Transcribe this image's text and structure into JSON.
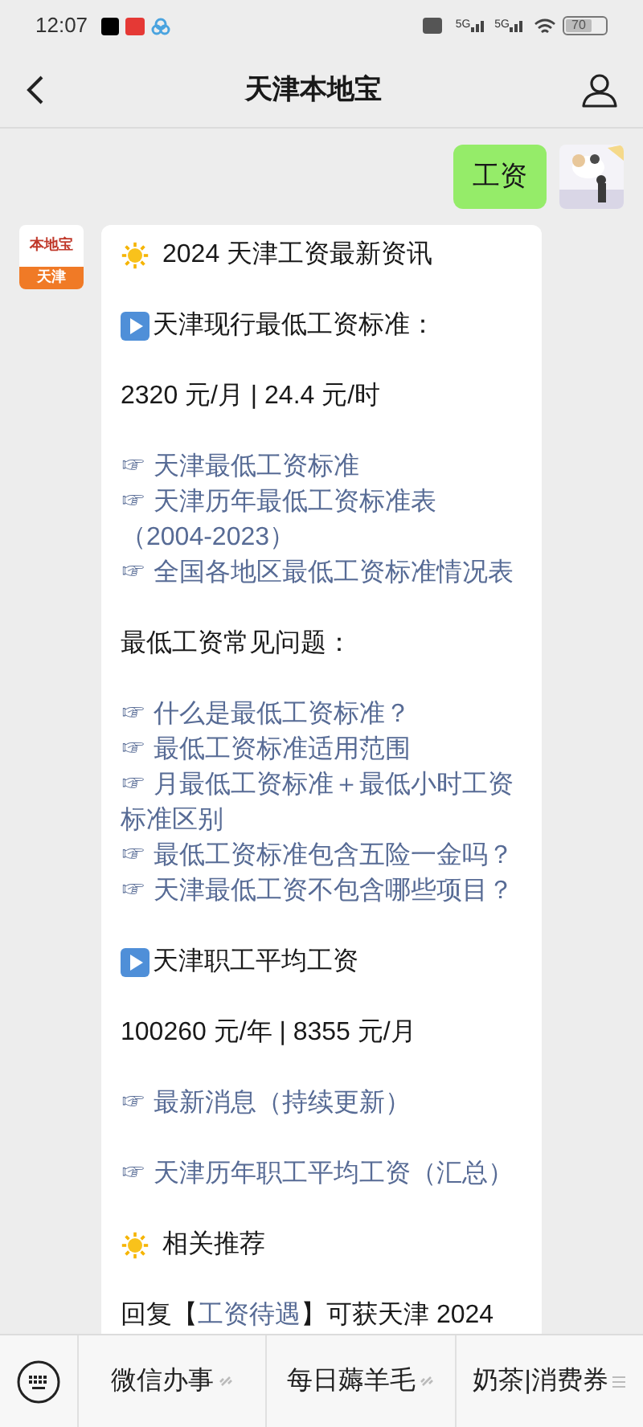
{
  "status_bar": {
    "time": "12:07",
    "networks": [
      "5G",
      "5G"
    ],
    "battery": "70"
  },
  "header": {
    "title": "天津本地宝"
  },
  "messages": [
    {
      "kind": "user",
      "text": "工资"
    },
    {
      "kind": "account",
      "logo_text": "本地宝",
      "logo_label": "天津",
      "blocks": [
        [
          {
            "kind": "heading",
            "text": "2024 天津工资最新资讯"
          }
        ],
        [
          {
            "kind": "section",
            "text": "天津现行最低工资标准："
          }
        ],
        [
          {
            "kind": "text",
            "text": "2320 元/月 | 24.4 元/时"
          }
        ],
        [
          {
            "kind": "link",
            "text": "☞ 天津最低工资标准"
          },
          {
            "kind": "link",
            "text": "☞ 天津历年最低工资标准表（2004-2023）"
          },
          {
            "kind": "link",
            "text": "☞ 全国各地区最低工资标准情况表"
          }
        ],
        [
          {
            "kind": "text",
            "text": "最低工资常见问题："
          }
        ],
        [
          {
            "kind": "link",
            "text": "☞ 什么是最低工资标准？"
          },
          {
            "kind": "link",
            "text": "☞ 最低工资标准适用范围"
          },
          {
            "kind": "link",
            "text": "☞ 月最低工资标准＋最低小时工资标准区别"
          },
          {
            "kind": "link",
            "text": "☞ 最低工资标准包含五险一金吗？"
          },
          {
            "kind": "link",
            "text": "☞ 天津最低工资不包含哪些项目？"
          }
        ],
        [
          {
            "kind": "section",
            "text": "天津职工平均工资"
          }
        ],
        [
          {
            "kind": "text",
            "text": "100260 元/年 | 8355 元/月"
          }
        ],
        [
          {
            "kind": "link",
            "text": "☞ 最新消息（持续更新）"
          }
        ],
        [
          {
            "kind": "link",
            "text": "☞ 天津历年职工平均工资（汇总）"
          }
        ],
        [
          {
            "kind": "heading",
            "text": "相关推荐"
          }
        ],
        [
          {
            "kind": "mixed",
            "parts": [
              {
                "kind": "text",
                "text": "回复【"
              },
              {
                "kind": "link",
                "text": "工资待遇"
              },
              {
                "kind": "text",
                "text": "】可获天津 2024"
              }
            ]
          }
        ]
      ]
    }
  ],
  "menu_bar": {
    "items": [
      {
        "kind": "link",
        "label": "微信办事"
      },
      {
        "kind": "link",
        "label": "每日薅羊毛"
      },
      {
        "kind": "menu",
        "label": "奶茶|消费券"
      }
    ]
  }
}
